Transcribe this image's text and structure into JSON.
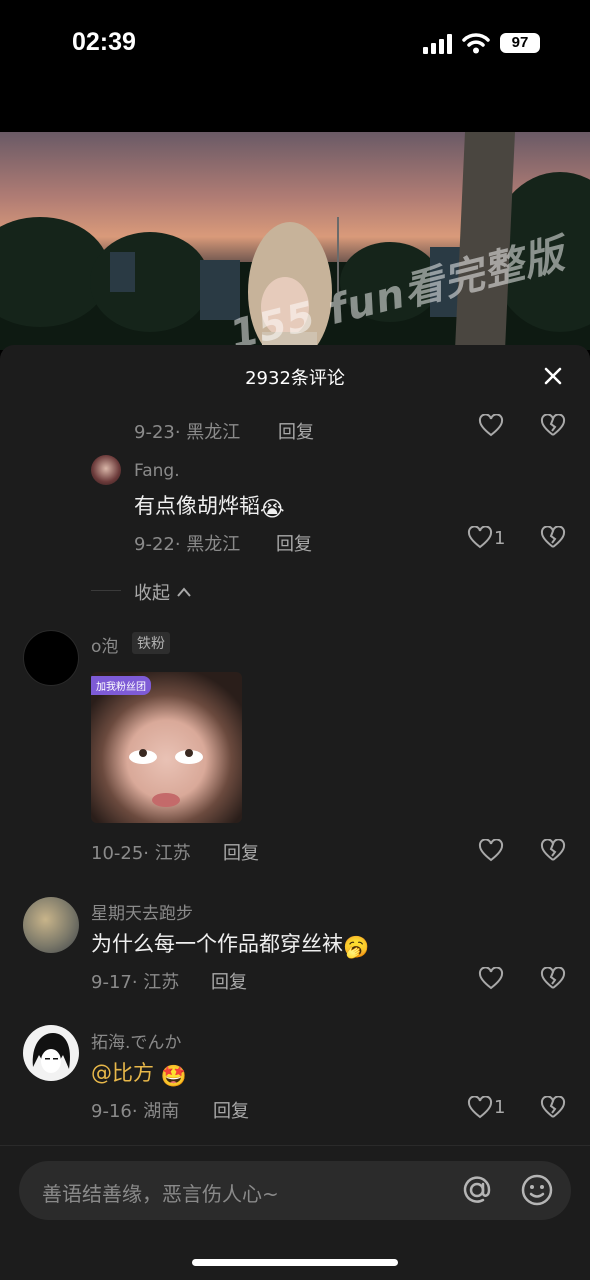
{
  "status_bar": {
    "time": "02:39",
    "battery": "97"
  },
  "video": {
    "watermark": "155 fun看完整版"
  },
  "comments_panel": {
    "title": "2932条评论",
    "items": [
      {
        "meta": "9-23· 黑龙江",
        "reply": "回复",
        "likes": ""
      },
      {
        "username": "Fang.",
        "text": "有点像胡烨韬",
        "emoji": "😭",
        "meta": "9-22· 黑龙江",
        "reply": "回复",
        "likes": "1"
      },
      {
        "collapse": "收起"
      },
      {
        "username": "o泡",
        "badge": "铁粉",
        "sticker_tag": "加我粉丝团",
        "meta": "10-25· 江苏",
        "reply": "回复",
        "likes": ""
      },
      {
        "username": "星期天去跑步",
        "text": "为什么每一个作品都穿丝袜",
        "emoji": "🥱",
        "meta": "9-17· 江苏",
        "reply": "回复",
        "likes": ""
      },
      {
        "username": "拓海.でんか",
        "text": "@比方",
        "emoji": "🤩",
        "meta": "9-16· 湖南",
        "reply": "回复",
        "likes": "1"
      }
    ]
  },
  "input": {
    "placeholder": "善语结善缘，恶言伤人心~"
  },
  "colors": {
    "sheet_bg": "#1c1c1c",
    "mention": "#e8b84a",
    "meta_text": "#8a8a8a"
  }
}
